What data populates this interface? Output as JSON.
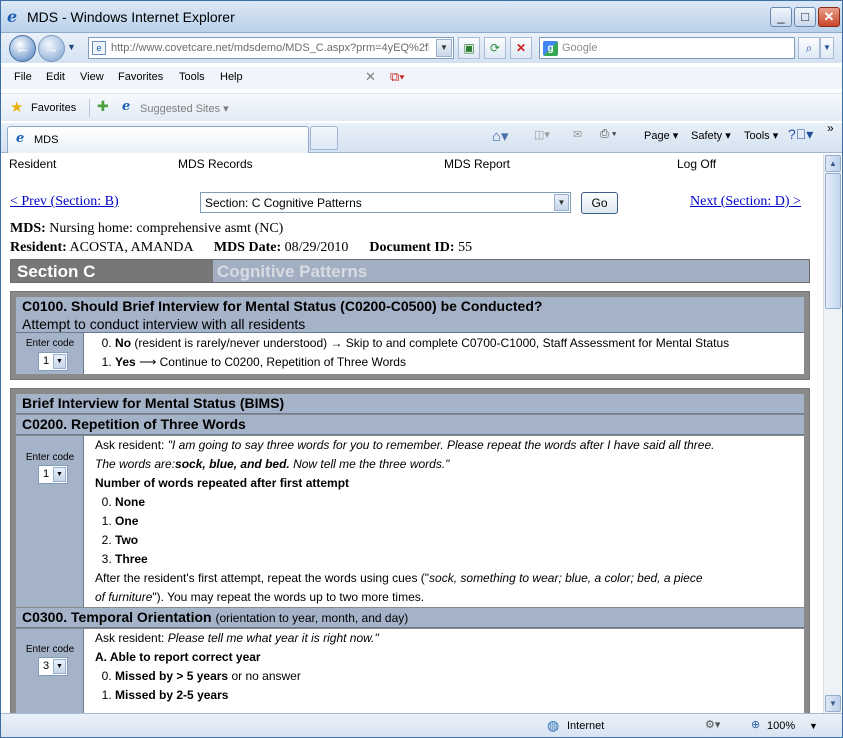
{
  "window": {
    "title": "MDS - Windows Internet Explorer",
    "min_label": "_",
    "max_label": "□",
    "close_label": "✕"
  },
  "navbar": {
    "url": "http://www.covetcare.net/mdsdemo/MDS_C.aspx?prm=4yEQ%2fl",
    "search_placeholder": "Google"
  },
  "menu": {
    "items": [
      "File",
      "Edit",
      "View",
      "Favorites",
      "Tools",
      "Help"
    ]
  },
  "favorites": {
    "label": "Favorites",
    "suggested": "Suggested Sites ▾"
  },
  "tabs": {
    "active": "MDS"
  },
  "commandbar": {
    "page": "Page ▾",
    "safety": "Safety ▾",
    "tools": "Tools ▾"
  },
  "topnav": [
    "Resident",
    "MDS Records",
    "MDS Report",
    "Log Off"
  ],
  "pager": {
    "prev": "< Prev (Section: B)",
    "next": "Next (Section: D) >",
    "section_value": "Section: C Cognitive Patterns",
    "go": "Go"
  },
  "meta": {
    "mds_label": "MDS:",
    "mds_value": "Nursing home: comprehensive asmt (NC)",
    "resident_label": "Resident:",
    "resident_value": "ACOSTA, AMANDA",
    "date_label": "MDS Date:",
    "date_value": "08/29/2010",
    "doc_label": "Document ID:",
    "doc_value": "55"
  },
  "section": {
    "code": "Section C",
    "name": "Cognitive Patterns"
  },
  "c0100": {
    "title": "C0100. Should Brief Interview for Mental Status (C0200-C0500) be Conducted?",
    "subtitle": "Attempt to conduct interview with all residents",
    "enter_code": "Enter code",
    "value": "1",
    "opt0_num": "0.",
    "opt0_bold": "No",
    "opt0_rest": "(resident is rarely/never understood) → Skip to and complete C0700-C1000, Staff Assessment for Mental Status",
    "opt1_num": "1.",
    "opt1_bold": "Yes",
    "opt1_rest": "⟶ Continue to C0200, Repetition of Three Words"
  },
  "bims": {
    "title": "Brief Interview for Mental Status (BIMS)"
  },
  "c0200": {
    "title": "C0200. Repetition of Three Words",
    "enter_code": "Enter code",
    "value": "1",
    "ask_label": "Ask resident:",
    "ask_text": "\"I am going to say three words for you to remember. Please repeat the words after I have said all three.",
    "ask_text2a": "The words are:",
    "ask_words": "sock, blue, and bed.",
    "ask_text2b": "Now tell me the three words.\"",
    "question": "Number of words repeated after first attempt",
    "options": [
      {
        "num": "0.",
        "label": "None"
      },
      {
        "num": "1.",
        "label": "One"
      },
      {
        "num": "2.",
        "label": "Two"
      },
      {
        "num": "3.",
        "label": "Three"
      }
    ],
    "after_a": "After the resident's first attempt, repeat the words using cues (\"",
    "after_b": "sock, something to wear; blue, a color; bed, a piece",
    "after_c": "of furniture",
    "after_d": "\"). You may repeat the words up to two more times."
  },
  "c0300": {
    "title": "C0300. Temporal Orientation",
    "title_note": "(orientation to year, month, and day)",
    "enter_code": "Enter code",
    "value": "3",
    "ask_label": "Ask resident:",
    "ask_text": "Please tell me what year it is right now.\"",
    "question": "A. Able to report correct year",
    "opt0_num": "0.",
    "opt0_bold": "Missed by > 5 years",
    "opt0_rest": "or no answer",
    "opt1_num": "1.",
    "opt1_bold": "Missed by 2-5 years"
  },
  "status": {
    "zone": "Internet",
    "zoom": "100%"
  }
}
